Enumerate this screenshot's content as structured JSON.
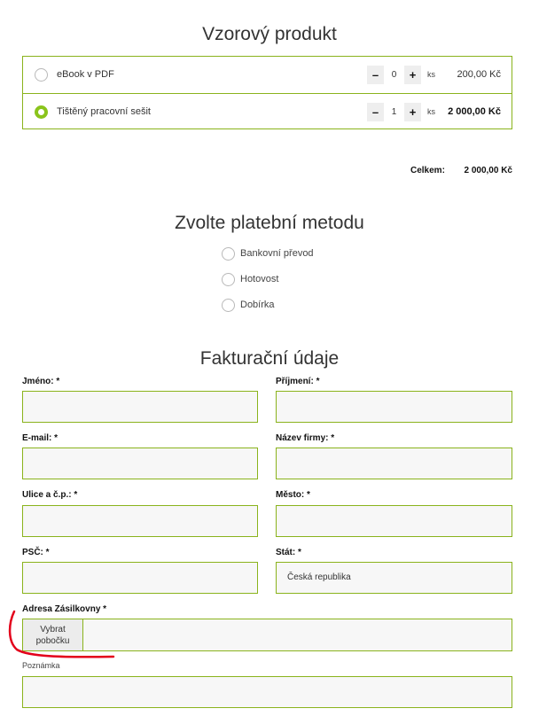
{
  "product": {
    "title": "Vzorový produkt",
    "items": [
      {
        "name": "eBook v PDF",
        "qty": "0",
        "unit": "ks",
        "price": "200,00 Kč",
        "selected": false
      },
      {
        "name": "Tištěný pracovní sešit",
        "qty": "1",
        "unit": "ks",
        "price": "2 000,00 Kč",
        "selected": true
      }
    ],
    "stepper": {
      "minus": "–",
      "plus": "+"
    },
    "total_label": "Celkem:",
    "total_value": "2 000,00 Kč"
  },
  "payment": {
    "title": "Zvolte platební metodu",
    "options": [
      "Bankovní převod",
      "Hotovost",
      "Dobírka"
    ]
  },
  "billing": {
    "title": "Fakturační údaje",
    "fields": {
      "first_name": {
        "label": "Jméno: *",
        "value": ""
      },
      "last_name": {
        "label": "Příjmení: *",
        "value": ""
      },
      "email": {
        "label": "E-mail: *",
        "value": ""
      },
      "company": {
        "label": "Název firmy: *",
        "value": ""
      },
      "street": {
        "label": "Ulice a č.p.: *",
        "value": ""
      },
      "city": {
        "label": "Město: *",
        "value": ""
      },
      "zip": {
        "label": "PSČ: *",
        "value": ""
      },
      "country": {
        "label": "Stát: *",
        "value": "Česká republika"
      }
    },
    "zasilkovna": {
      "label": "Adresa Zásilkovny *",
      "button": "Vybrat pobočku"
    },
    "note": {
      "label": "Poznámka",
      "value": ""
    }
  },
  "colors": {
    "accent": "#8ab31c",
    "radio_checked": "#8ac41c",
    "highlight": "#e3001b"
  }
}
